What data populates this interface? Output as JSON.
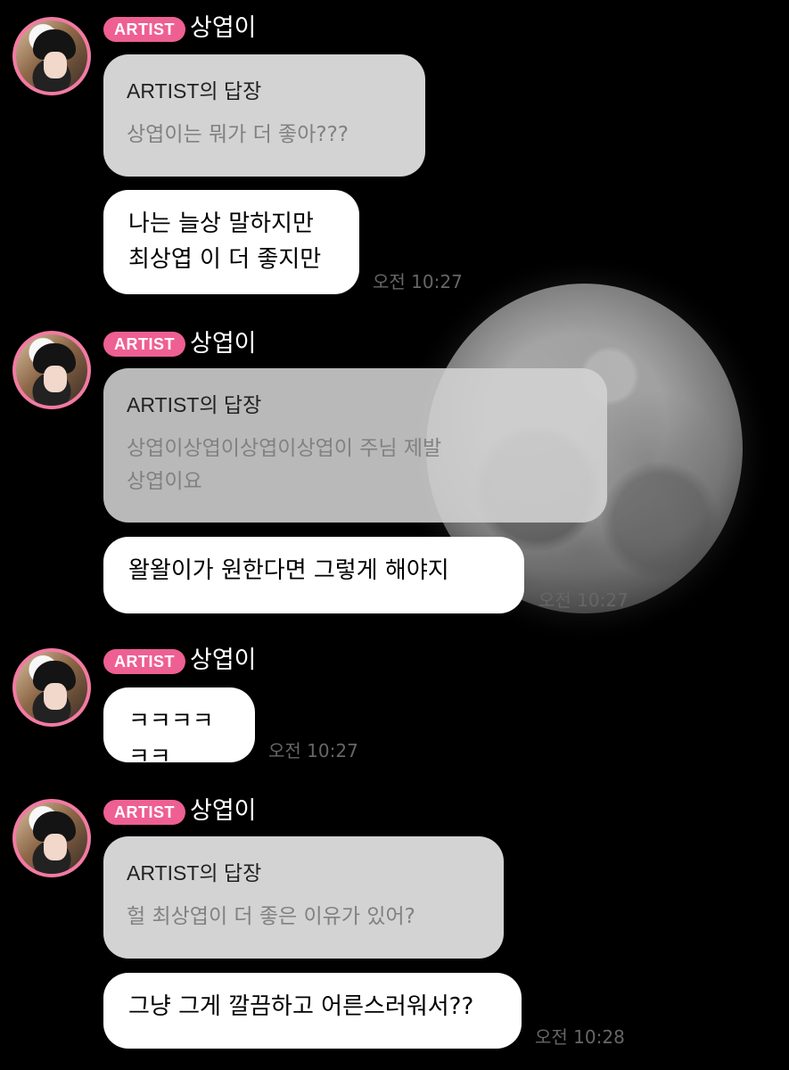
{
  "chat": {
    "messages": [
      {
        "artist_tag": "ARTIST",
        "sender": "상엽이",
        "reply_title": "ARTIST의 답장",
        "reply_text": "상엽이는 뭐가 더 좋아???",
        "message": "나는 늘상 말하지만\n최상엽 이 더 좋지만",
        "time": "오전 10:27"
      },
      {
        "artist_tag": "ARTIST",
        "sender": "상엽이",
        "reply_title": "ARTIST의 답장",
        "reply_text": "상엽이상엽이상엽이상엽이 주님 제발\n상엽이요",
        "message": "왈왈이가 원한다면 그렇게 해야지",
        "time": "오전 10:27"
      },
      {
        "artist_tag": "ARTIST",
        "sender": "상엽이",
        "message": "ㅋㅋㅋㅋㅋㅋ",
        "time": "오전 10:27"
      },
      {
        "artist_tag": "ARTIST",
        "sender": "상엽이",
        "reply_title": "ARTIST의 답장",
        "reply_text": "헐 최상엽이 더 좋은 이유가 있어?",
        "message": "그냥 그게 깔끔하고 어른스러워서??",
        "time": "오전 10:28"
      }
    ]
  },
  "background": {
    "color": "#000000",
    "moon_icon": "moon-background"
  },
  "colors": {
    "tag": "#ee5f92",
    "avatar_ring": "#f27aa3",
    "reply_card": "#d3d3d3",
    "message_card": "#ffffff",
    "time_text": "#666666"
  }
}
